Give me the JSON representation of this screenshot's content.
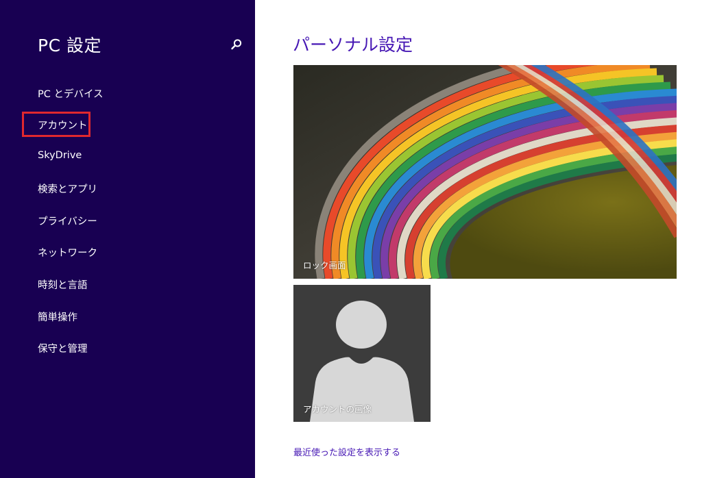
{
  "sidebar": {
    "title": "PC 設定",
    "items": [
      {
        "label": "PC とデバイス"
      },
      {
        "label": "アカウント",
        "highlighted": true
      },
      {
        "label": "SkyDrive"
      },
      {
        "label": "検索とアプリ"
      },
      {
        "label": "プライバシー"
      },
      {
        "label": "ネットワーク"
      },
      {
        "label": "時刻と言語"
      },
      {
        "label": "簡単操作"
      },
      {
        "label": "保守と管理"
      }
    ],
    "background_color": "#180052",
    "highlight_color": "#e0282e"
  },
  "main": {
    "title": "パーソナル設定",
    "title_color": "#4617b4",
    "lock_screen_label": "ロック画面",
    "account_picture_label": "アカウントの画像",
    "recent_settings_link": "最近使った設定を表示する"
  },
  "icons": {
    "search": "search-icon",
    "avatar": "user-silhouette-icon"
  }
}
